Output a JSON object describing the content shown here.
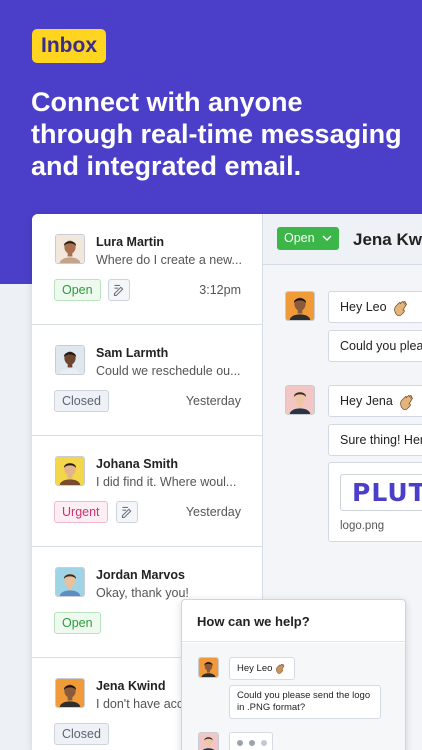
{
  "hero": {
    "badge": "Inbox",
    "headline": "Connect with anyone through real-time messaging and integrated email."
  },
  "conversations": [
    {
      "name": "Lura Martin",
      "preview": "Where do I create a new...",
      "status": "Open",
      "time": "3:12pm",
      "has_note": true,
      "skin": "#a8704e",
      "hair": "#2d1d14",
      "bg": "#f1e7dc",
      "shirt": "#c4a48a"
    },
    {
      "name": "Sam Larmth",
      "preview": "Could we reschedule ou...",
      "status": "Closed",
      "time": "Yesterday",
      "has_note": false,
      "skin": "#6d4630",
      "hair": "#1c1410",
      "bg": "#dfe7ef",
      "shirt": "#e9eef3"
    },
    {
      "name": "Johana Smith",
      "preview": "I did find it. Where woul...",
      "status": "Urgent",
      "time": "Yesterday",
      "has_note": true,
      "skin": "#e2b48d",
      "hair": "#2a1c14",
      "bg": "#f3d64a",
      "shirt": "#7a4a30"
    },
    {
      "name": "Jordan Marvos",
      "preview": "Okay, thank you!",
      "status": "Open",
      "time": "",
      "has_note": false,
      "skin": "#e8c09c",
      "hair": "#3b2a1e",
      "bg": "#9fd4e6",
      "shirt": "#5b8fc3"
    },
    {
      "name": "Jena Kwind",
      "preview": "I don't have acc",
      "status": "Closed",
      "time": "",
      "has_note": false,
      "skin": "#8a5a3c",
      "hair": "#1a120e",
      "bg": "#f09a3a",
      "shirt": "#2e2e2e"
    }
  ],
  "chat": {
    "status_label": "Open",
    "title": "Jena Kw",
    "messages": [
      {
        "text": "Hey Leo",
        "wave": true
      },
      {
        "text": "Could you plea",
        "wave": false
      },
      {
        "text": "Hey Jena",
        "wave": true
      },
      {
        "text": "Sure thing! Her",
        "wave": false
      }
    ],
    "attachment": {
      "logo_text": "PLUTIO",
      "filename": "logo.png"
    }
  },
  "widget": {
    "title": "How can we help?",
    "msg1": "Hey Leo",
    "msg2": "Could you please send the logo in .PNG format?"
  },
  "colors": {
    "hero": "#4b3fc9",
    "badge": "#ffd51f",
    "open": "#3cb649",
    "urgent": "#d0306f"
  }
}
